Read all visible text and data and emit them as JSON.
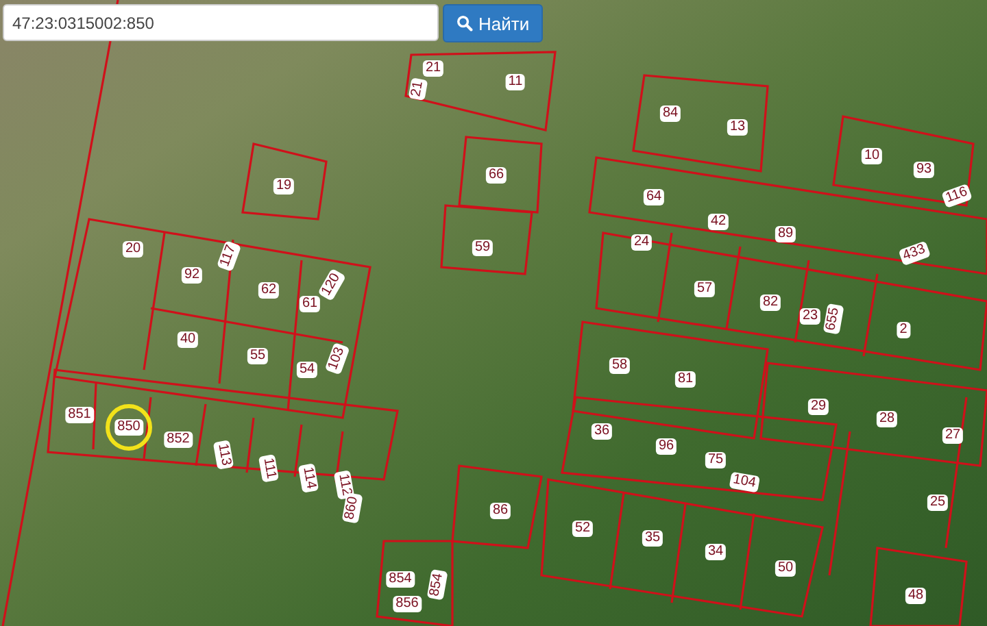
{
  "search": {
    "value": "47:23:0315002:850"
  },
  "search_button": {
    "label": "Найти"
  },
  "parcels": [
    {
      "label": "21",
      "kind": "plain",
      "selected": false
    },
    {
      "label": "11",
      "kind": "plain",
      "selected": false
    },
    {
      "label": "21",
      "kind": "rotated",
      "selected": false
    },
    {
      "label": "84",
      "kind": "plain",
      "selected": false
    },
    {
      "label": "13",
      "kind": "plain",
      "selected": false
    },
    {
      "label": "10",
      "kind": "plain",
      "selected": false
    },
    {
      "label": "93",
      "kind": "plain",
      "selected": false
    },
    {
      "label": "116",
      "kind": "rotated",
      "selected": false
    },
    {
      "label": "66",
      "kind": "plain",
      "selected": false
    },
    {
      "label": "19",
      "kind": "plain",
      "selected": false
    },
    {
      "label": "64",
      "kind": "plain",
      "selected": false
    },
    {
      "label": "42",
      "kind": "plain",
      "selected": false
    },
    {
      "label": "89",
      "kind": "plain",
      "selected": false
    },
    {
      "label": "433",
      "kind": "rotated",
      "selected": false
    },
    {
      "label": "20",
      "kind": "plain",
      "selected": false
    },
    {
      "label": "59",
      "kind": "plain",
      "selected": false
    },
    {
      "label": "92",
      "kind": "plain",
      "selected": false
    },
    {
      "label": "117",
      "kind": "rotated",
      "selected": false
    },
    {
      "label": "62",
      "kind": "plain",
      "selected": false
    },
    {
      "label": "61",
      "kind": "plain",
      "selected": false
    },
    {
      "label": "120",
      "kind": "rotated",
      "selected": false
    },
    {
      "label": "24",
      "kind": "plain",
      "selected": false
    },
    {
      "label": "57",
      "kind": "plain",
      "selected": false
    },
    {
      "label": "82",
      "kind": "plain",
      "selected": false
    },
    {
      "label": "23",
      "kind": "plain",
      "selected": false
    },
    {
      "label": "655",
      "kind": "rotated",
      "selected": false
    },
    {
      "label": "2",
      "kind": "plain",
      "selected": false
    },
    {
      "label": "40",
      "kind": "plain",
      "selected": false
    },
    {
      "label": "55",
      "kind": "plain",
      "selected": false
    },
    {
      "label": "54",
      "kind": "plain",
      "selected": false
    },
    {
      "label": "103",
      "kind": "rotated",
      "selected": false
    },
    {
      "label": "58",
      "kind": "plain",
      "selected": false
    },
    {
      "label": "81",
      "kind": "plain",
      "selected": false
    },
    {
      "label": "29",
      "kind": "plain",
      "selected": false
    },
    {
      "label": "28",
      "kind": "plain",
      "selected": false
    },
    {
      "label": "27",
      "kind": "plain",
      "selected": false
    },
    {
      "label": "851",
      "kind": "plain",
      "selected": false
    },
    {
      "label": "850",
      "kind": "plain",
      "selected": true
    },
    {
      "label": "852",
      "kind": "plain",
      "selected": false
    },
    {
      "label": "113",
      "kind": "rotated",
      "selected": false
    },
    {
      "label": "111",
      "kind": "rotated",
      "selected": false
    },
    {
      "label": "114",
      "kind": "rotated",
      "selected": false
    },
    {
      "label": "112",
      "kind": "rotated",
      "selected": false
    },
    {
      "label": "860",
      "kind": "rotated",
      "selected": false
    },
    {
      "label": "36",
      "kind": "plain",
      "selected": false
    },
    {
      "label": "96",
      "kind": "plain",
      "selected": false
    },
    {
      "label": "75",
      "kind": "plain",
      "selected": false
    },
    {
      "label": "104",
      "kind": "rotated",
      "selected": false
    },
    {
      "label": "86",
      "kind": "plain",
      "selected": false
    },
    {
      "label": "25",
      "kind": "plain",
      "selected": false
    },
    {
      "label": "52",
      "kind": "plain",
      "selected": false
    },
    {
      "label": "35",
      "kind": "plain",
      "selected": false
    },
    {
      "label": "34",
      "kind": "plain",
      "selected": false
    },
    {
      "label": "50",
      "kind": "plain",
      "selected": false
    },
    {
      "label": "854",
      "kind": "plain",
      "selected": false
    },
    {
      "label": "854",
      "kind": "rotated",
      "selected": false
    },
    {
      "label": "856",
      "kind": "plain",
      "selected": false
    },
    {
      "label": "48",
      "kind": "plain",
      "selected": false
    }
  ]
}
